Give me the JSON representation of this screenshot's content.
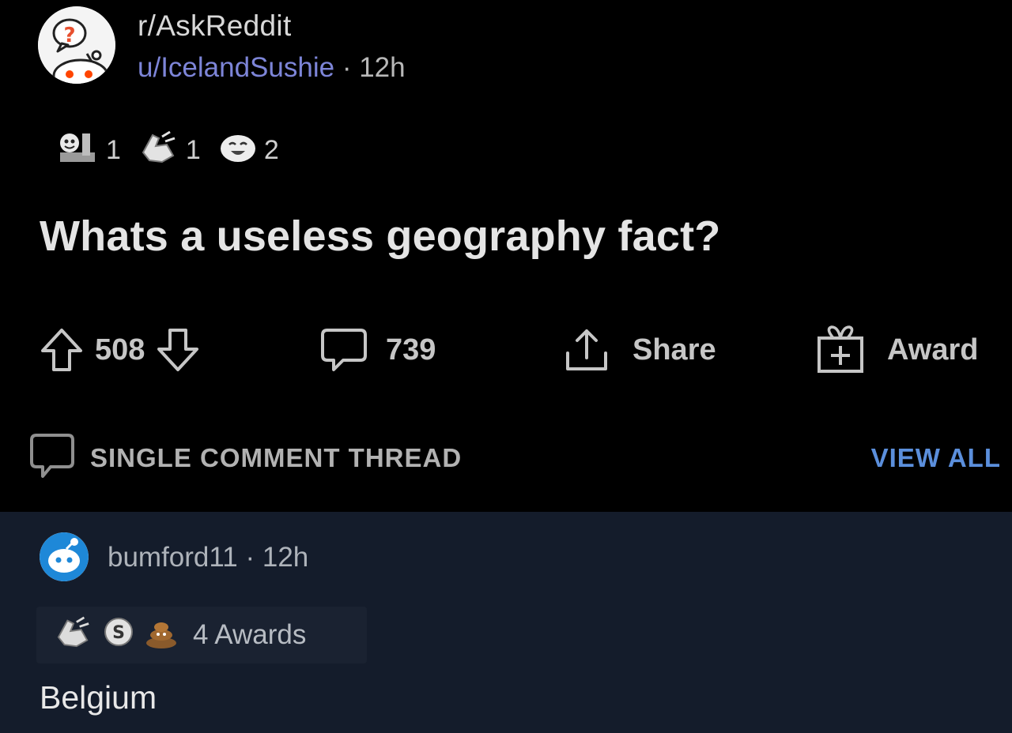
{
  "colors": {
    "background": "#000000",
    "comment_background": "#141c2b",
    "username": "#7d85d8",
    "view_all": "#5b8fdc",
    "text_primary": "#e4e4e4",
    "text_secondary": "#b8b8b8"
  },
  "post": {
    "subreddit": "r/AskReddit",
    "author": "u/IcelandSushie",
    "separator": "·",
    "age": "12h",
    "awards": [
      {
        "icon": "wholesome-award-icon",
        "count": "1"
      },
      {
        "icon": "bravo-award-icon",
        "count": "1"
      },
      {
        "icon": "haha-award-icon",
        "count": "2"
      }
    ],
    "title": "Whats a useless geography fact?",
    "score": "508",
    "comment_count": "739",
    "share_label": "Share",
    "award_label": "Award"
  },
  "thread": {
    "label": "SINGLE COMMENT THREAD",
    "view_all": "VIEW ALL"
  },
  "comment": {
    "author": "bumford11",
    "separator": "·",
    "age": "12h",
    "award_icons": [
      "bravo-award-icon",
      "silver-award-icon",
      "poop-award-icon"
    ],
    "awards_label": "4 Awards",
    "body": "Belgium"
  }
}
